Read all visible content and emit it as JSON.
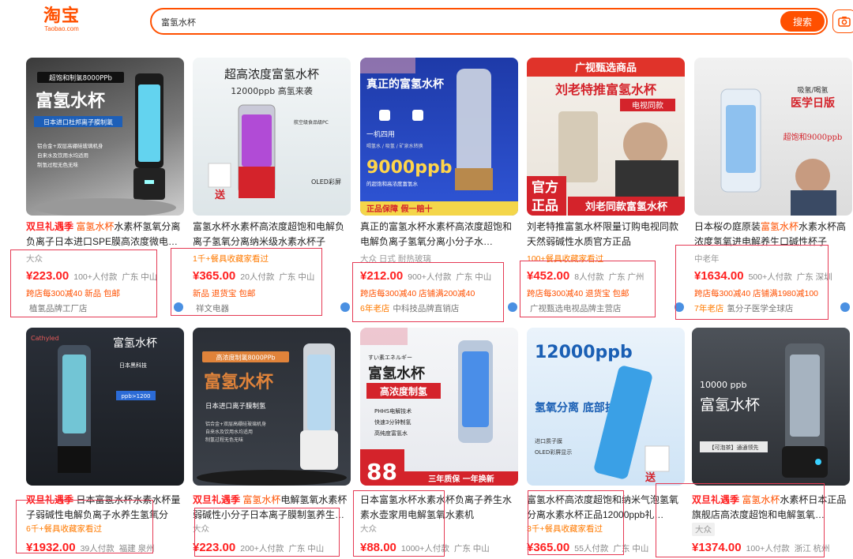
{
  "header": {
    "logo_cn": "淘宝",
    "logo_en": "Taobao.com",
    "search_value": "富氢水杯",
    "search_button": "搜索"
  },
  "colors": {
    "accent": "#ff5000",
    "price": "#ff2020",
    "annotation": "#e53a54"
  },
  "products": [
    {
      "promo": "双旦礼遇季 ",
      "title_kw": "富氢水杯",
      "title_rest": "水素杯氢氧分离负离子日本进口SPE膜高浓度微电…",
      "tag": "大众",
      "price": "¥223.00",
      "sales": "100+人付款",
      "location": "广东 中山",
      "promo_line": "跨店每300减40 新品 包邮",
      "store_age": "",
      "store": "植氢品牌工厂店"
    },
    {
      "promo": "",
      "title_kw": "",
      "title_rest": "富氢水杯水素杯高浓度超饱和电解负离子氢氧分离纳米级水素水杯子",
      "tag": "1千+餐具收藏家看过",
      "price": "¥365.00",
      "sales": "20人付款",
      "location": "广东 中山",
      "promo_line": "新品 退货宝 包邮",
      "store_age": "",
      "store": "祥文电器"
    },
    {
      "promo": "",
      "title_kw": "",
      "title_rest": "真正的富氢水杯水素杯高浓度超饱和电解负离子氢氧分离小分子水…",
      "tag": "大众 日式 耐热玻璃",
      "price": "¥212.00",
      "sales": "900+人付款",
      "location": "广东 中山",
      "promo_line": "跨店每300减40 店铺满200减40",
      "store_age": "6年老店",
      "store": "中科技品牌直销店"
    },
    {
      "promo": "",
      "title_kw": "",
      "title_rest": "刘老特推富氢水杯限量订购电视同款天然弱碱性水质官方正品",
      "tag": "100+餐具收藏家看过",
      "price": "¥452.00",
      "sales": "8人付款",
      "location": "广东 广州",
      "promo_line": "跨店每300减40 退货宝 包邮",
      "store_age": "",
      "store": "广视甄选电视品牌主营店"
    },
    {
      "promo": "",
      "title_kw": "富氢水杯",
      "title_pre": "日本桜の庭原装",
      "title_rest": "水素水杯高浓度氢氧进电解养生口碱性杯子",
      "tag": "中老年",
      "price": "¥1634.00",
      "sales": "500+人付款",
      "location": "广东 深圳",
      "promo_line": "跨店每300减40 店铺满1980减100",
      "store_age": "7年老店",
      "store": "氢分子医学全球店"
    },
    {
      "promo": "双旦礼遇季 ",
      "title_kw": "",
      "title_rest": "日本富氢水杯水素水杯量子弱碱性电解负离子水养生氢氧分离…",
      "tag": "6千+餐具收藏家看过",
      "price": "¥1932.00",
      "sales": "39人付款",
      "location": "福建 泉州"
    },
    {
      "promo": "双旦礼遇季 ",
      "title_kw": "富氢水杯",
      "title_rest": "电解氢氧水素杯弱碱性小分子日本离子膜制氢养生…",
      "tag": "大众",
      "price": "¥223.00",
      "sales": "200+人付款",
      "location": "广东 中山"
    },
    {
      "promo": "",
      "title_kw": "",
      "title_rest": "日本富氢水杯水素水杯负离子养生水素水壶家用电解氢氧水素机",
      "tag": "大众",
      "price": "¥88.00",
      "sales": "1000+人付款",
      "location": "广东 中山"
    },
    {
      "promo": "",
      "title_kw": "",
      "title_rest": "富氢水杯高浓度超饱和纳米气泡氢氧分离水素水杯正品12000ppb礼…",
      "tag": "3千+餐具收藏家看过",
      "price": "¥365.00",
      "sales": "55人付款",
      "location": "广东 中山"
    },
    {
      "promo": "双旦礼遇季 ",
      "title_kw": "富氢水杯",
      "title_rest": "水素杯日本正品旗舰店高浓度超饱和电解氢氧…",
      "tag": "大众",
      "price": "¥1374.00",
      "sales": "100+人付款",
      "location": "浙江 杭州"
    }
  ],
  "images": [
    {
      "badge": "超饱和制氢8000PPb",
      "headline": "富氢水杯",
      "sub": "日本进口杜邦离子膜制氢",
      "lines": [
        "铝合金+双层高硼硅玻璃机身",
        "自来水及饮用水均适用",
        "制氢过程无色无味"
      ]
    },
    {
      "badge": "",
      "headline": "超高浓度富氢水杯",
      "sub": "12000ppb 高氢来袭",
      "lines": [
        "航空级食品级PC",
        "OLED彩屏",
        "送"
      ]
    },
    {
      "badge": "",
      "headline": "真正的富氢水杯",
      "sub": "一机四用",
      "lines": [
        "喝氢水 / 吸氢 / 矿泉水转换",
        "9000ppb",
        "的超饱和高浓度富氢水",
        "正品保障 假一赔十"
      ]
    },
    {
      "badge": "广视甄选商品",
      "headline": "刘老特推富氢水杯",
      "sub": "电视同款",
      "lines": [
        "官方",
        "正品",
        "刘老同款富氢水杯"
      ]
    },
    {
      "badge": "",
      "headline": "医学日版",
      "sub": "吸氢/喝氢",
      "lines": [
        "超饱和9000ppb"
      ]
    },
    {
      "badge": "Cathyled",
      "headline": "富氢水杯",
      "sub": "日本黑科技",
      "lines": [
        "ppb>1200"
      ]
    },
    {
      "badge": "高浓度制氢8000PPb",
      "headline": "富氢水杯",
      "sub": "日本进口离子膜制氢",
      "lines": [
        "铝合金+双层高硼硅玻璃机身",
        "自来水及饮用水均适用",
        "制氢过程无色无味"
      ]
    },
    {
      "badge": "すい素エネルギー",
      "headline": "富氢水杯",
      "sub": "高浓度制氢",
      "lines": [
        "PHHS电解技术",
        "快速3分钟制氢",
        "高纯度富氢水",
        "88",
        "三年质保 一年换新"
      ]
    },
    {
      "badge": "",
      "headline": "12000ppb",
      "sub": "氢氧分离 底部排氧",
      "lines": [
        "进口质子膜",
        "OLED彩屏显示",
        "送"
      ]
    },
    {
      "badge": "",
      "headline": "富氢水杯",
      "sub": "10000 ppb",
      "lines": [
        "【可泡茶】通通领先"
      ]
    }
  ]
}
